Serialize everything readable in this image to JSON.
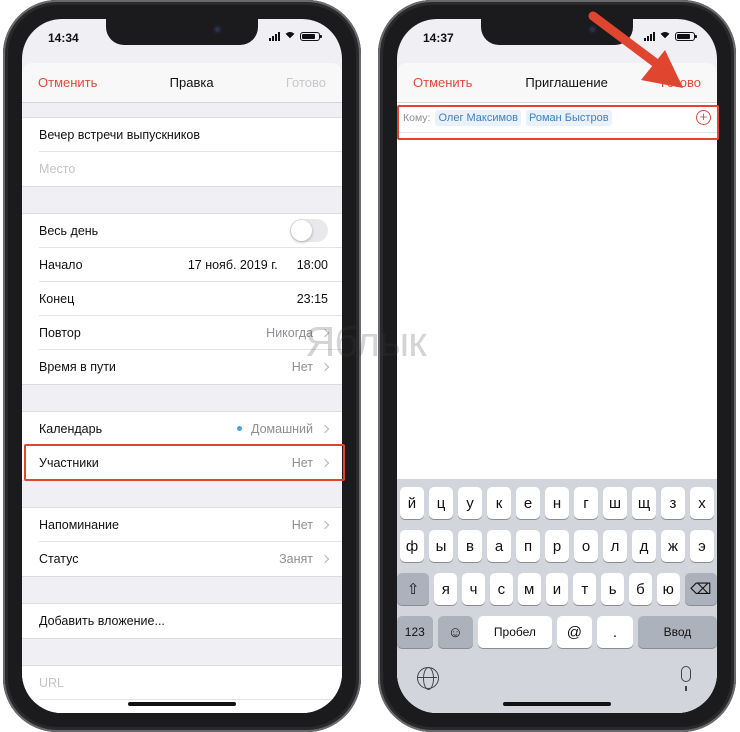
{
  "left": {
    "status_time": "14:34",
    "nav": {
      "cancel": "Отменить",
      "title": "Правка",
      "done": "Готово"
    },
    "event_title": "Вечер встречи выпускников",
    "location_placeholder": "Место",
    "all_day_label": "Весь день",
    "start": {
      "label": "Начало",
      "date": "17 нояб. 2019 г.",
      "time": "18:00"
    },
    "end": {
      "label": "Конец",
      "time": "23:15"
    },
    "repeat": {
      "label": "Повтор",
      "value": "Никогда"
    },
    "travel": {
      "label": "Время в пути",
      "value": "Нет"
    },
    "calendar": {
      "label": "Календарь",
      "value": "Домашний"
    },
    "invitees": {
      "label": "Участники",
      "value": "Нет"
    },
    "alert": {
      "label": "Напоминание",
      "value": "Нет"
    },
    "show_as": {
      "label": "Статус",
      "value": "Занят"
    },
    "attachment": "Добавить вложение...",
    "url_placeholder": "URL"
  },
  "right": {
    "status_time": "14:37",
    "nav": {
      "cancel": "Отменить",
      "title": "Приглашение",
      "done": "Готово"
    },
    "to_label": "Кому:",
    "recipients": [
      "Олег Максимов",
      "Роман Быстров"
    ],
    "keyboard": {
      "row1": [
        "й",
        "ц",
        "у",
        "к",
        "е",
        "н",
        "г",
        "ш",
        "щ",
        "з",
        "х"
      ],
      "row2": [
        "ф",
        "ы",
        "в",
        "а",
        "п",
        "р",
        "о",
        "л",
        "д",
        "ж",
        "э"
      ],
      "row3": [
        "я",
        "ч",
        "с",
        "м",
        "и",
        "т",
        "ь",
        "б",
        "ю"
      ],
      "num_key": "123",
      "space": "Пробел",
      "at": "@",
      "dot": ".",
      "enter": "Ввод"
    }
  },
  "watermark": "Яблык",
  "colors": {
    "accent": "#e2493b",
    "highlight": "#e0462f",
    "chip_text": "#3b82c4"
  }
}
